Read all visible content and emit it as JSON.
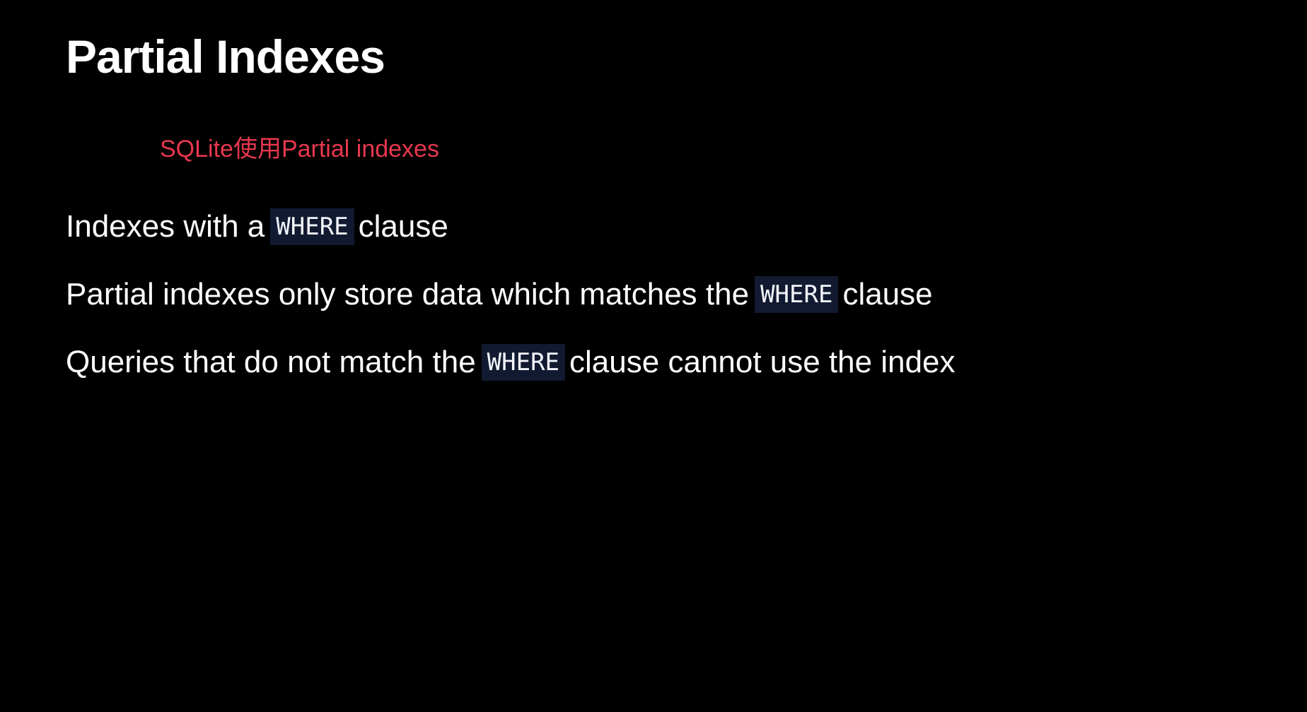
{
  "slide": {
    "title": "Partial Indexes",
    "annotation": "SQLite使用Partial indexes",
    "bullets": [
      {
        "before": "Indexes with a",
        "code": "WHERE",
        "after": "clause"
      },
      {
        "before": "Partial indexes only store data which matches the",
        "code": "WHERE",
        "after": "clause"
      },
      {
        "before": "Queries that do not match the",
        "code": "WHERE",
        "after": "clause cannot use the index"
      }
    ]
  },
  "colors": {
    "background": "#000000",
    "text": "#ffffff",
    "annotation": "#e8384f",
    "code_background": "#111a30"
  }
}
